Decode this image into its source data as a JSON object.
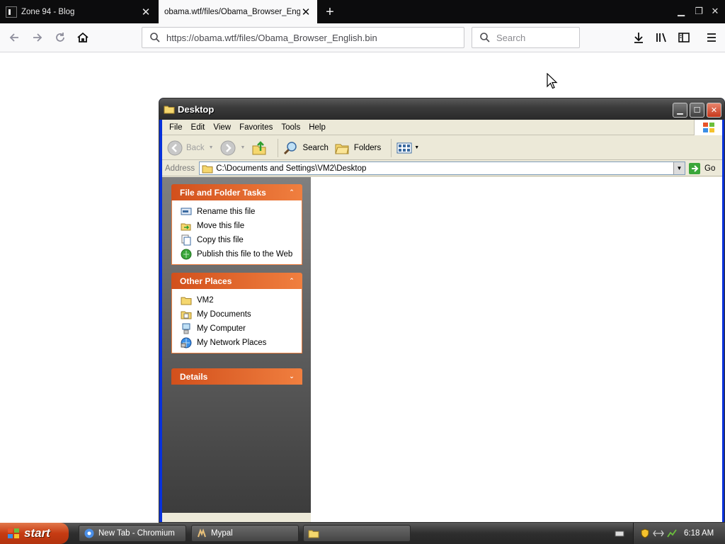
{
  "browser": {
    "tabs": [
      {
        "title": "Zone 94 - Blog"
      },
      {
        "title": "obama.wtf/files/Obama_Browser_Engli"
      }
    ],
    "url": "https://obama.wtf/files/Obama_Browser_English.bin",
    "search_placeholder": "Search"
  },
  "explorer": {
    "title": "Desktop",
    "menu": [
      "File",
      "Edit",
      "View",
      "Favorites",
      "Tools",
      "Help"
    ],
    "toolbar": {
      "back": "Back",
      "search": "Search",
      "folders": "Folders"
    },
    "address": {
      "label": "Address",
      "path": "C:\\Documents and Settings\\VM2\\Desktop",
      "go": "Go"
    },
    "panels": {
      "file_tasks": {
        "title": "File and Folder Tasks",
        "items": [
          "Rename this file",
          "Move this file",
          "Copy this file",
          "Publish this file to the Web"
        ]
      },
      "other_places": {
        "title": "Other Places",
        "items": [
          "VM2",
          "My Documents",
          "My Computer",
          "My Network Places"
        ]
      },
      "details": {
        "title": "Details"
      }
    }
  },
  "taskbar": {
    "start": "start",
    "items": [
      "New Tab - Chromium",
      "Mypal"
    ],
    "clock": "6:18 AM"
  },
  "colors": {
    "accent": "#f07f3f",
    "panel_head": "#d2501c",
    "titlebar": "#3c3c3c"
  }
}
